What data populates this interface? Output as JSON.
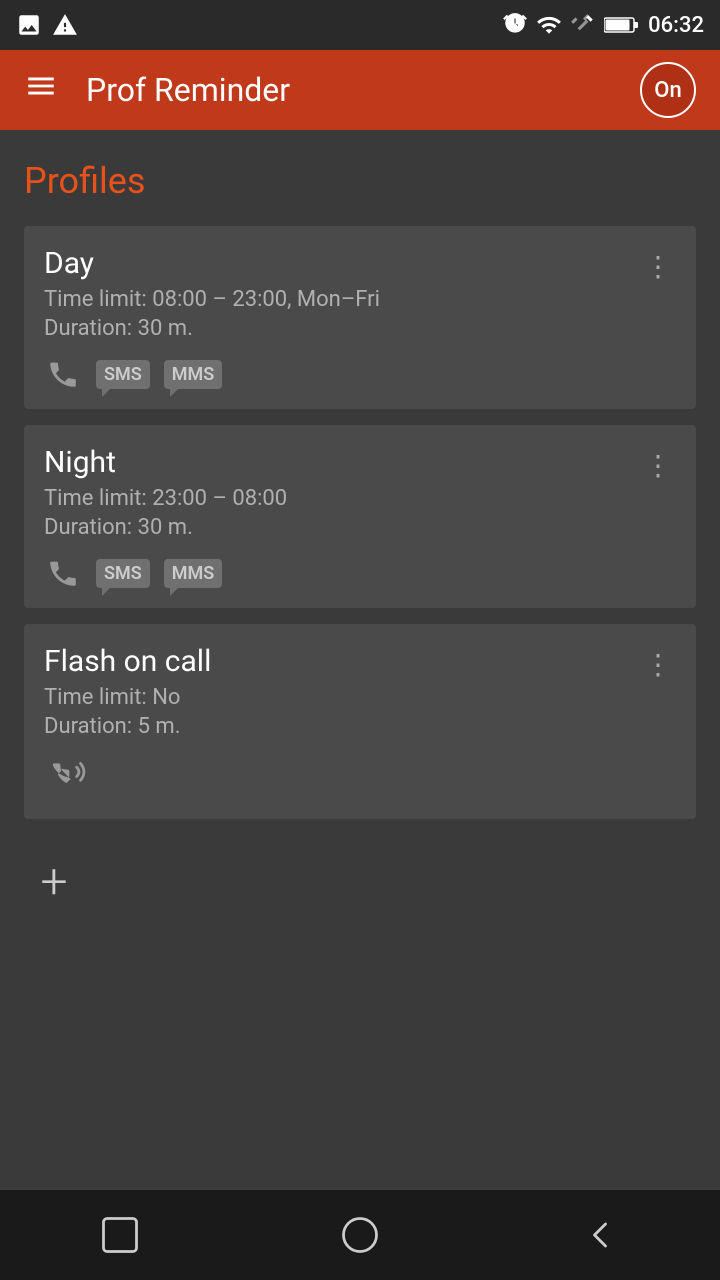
{
  "status_bar": {
    "time": "06:32",
    "icons": [
      "photo-icon",
      "alert-icon",
      "alarm-icon",
      "wifi-icon",
      "signal-icon",
      "battery-icon"
    ]
  },
  "app_bar": {
    "title": "Prof Reminder",
    "menu_label": "menu",
    "on_label": "On"
  },
  "section": {
    "title": "Profiles"
  },
  "profiles": [
    {
      "name": "Day",
      "time_limit": "Time limit: 08:00 – 23:00, Mon–Fri",
      "duration": "Duration: 30 m.",
      "icons": [
        "phone",
        "sms",
        "mms"
      ]
    },
    {
      "name": "Night",
      "time_limit": "Time limit: 23:00 – 08:00",
      "duration": "Duration: 30 m.",
      "icons": [
        "phone",
        "sms",
        "mms"
      ]
    },
    {
      "name": "Flash on call",
      "time_limit": "Time limit: No",
      "duration": "Duration: 5 m.",
      "icons": [
        "flash-call"
      ]
    }
  ],
  "add_button_label": "+",
  "colors": {
    "accent": "#e8521a",
    "appbar": "#c0391b",
    "card_bg": "#4a4a4a",
    "bg": "#3a3a3a"
  }
}
